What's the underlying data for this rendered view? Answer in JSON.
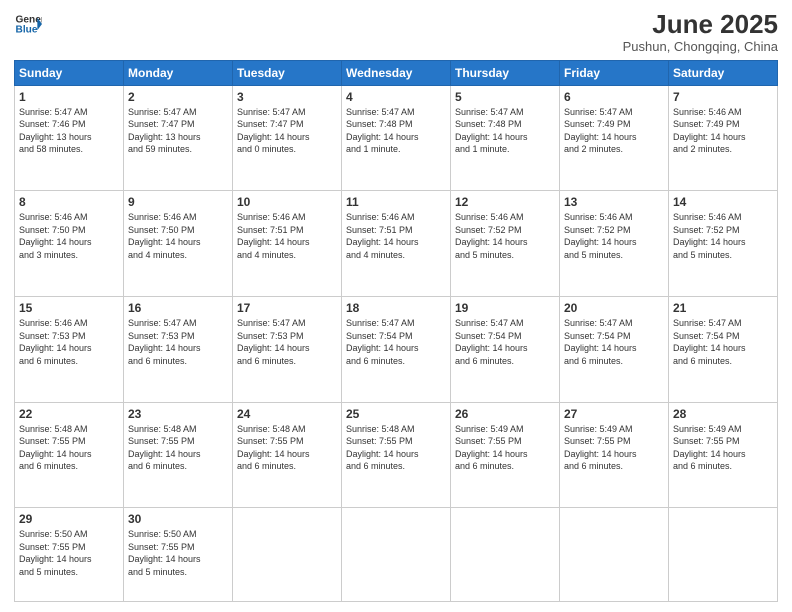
{
  "header": {
    "logo_line1": "General",
    "logo_line2": "Blue",
    "month_year": "June 2025",
    "location": "Pushun, Chongqing, China"
  },
  "weekdays": [
    "Sunday",
    "Monday",
    "Tuesday",
    "Wednesday",
    "Thursday",
    "Friday",
    "Saturday"
  ],
  "weeks": [
    [
      {
        "day": "1",
        "info": "Sunrise: 5:47 AM\nSunset: 7:46 PM\nDaylight: 13 hours\nand 58 minutes."
      },
      {
        "day": "2",
        "info": "Sunrise: 5:47 AM\nSunset: 7:47 PM\nDaylight: 13 hours\nand 59 minutes."
      },
      {
        "day": "3",
        "info": "Sunrise: 5:47 AM\nSunset: 7:47 PM\nDaylight: 14 hours\nand 0 minutes."
      },
      {
        "day": "4",
        "info": "Sunrise: 5:47 AM\nSunset: 7:48 PM\nDaylight: 14 hours\nand 1 minute."
      },
      {
        "day": "5",
        "info": "Sunrise: 5:47 AM\nSunset: 7:48 PM\nDaylight: 14 hours\nand 1 minute."
      },
      {
        "day": "6",
        "info": "Sunrise: 5:47 AM\nSunset: 7:49 PM\nDaylight: 14 hours\nand 2 minutes."
      },
      {
        "day": "7",
        "info": "Sunrise: 5:46 AM\nSunset: 7:49 PM\nDaylight: 14 hours\nand 2 minutes."
      }
    ],
    [
      {
        "day": "8",
        "info": "Sunrise: 5:46 AM\nSunset: 7:50 PM\nDaylight: 14 hours\nand 3 minutes."
      },
      {
        "day": "9",
        "info": "Sunrise: 5:46 AM\nSunset: 7:50 PM\nDaylight: 14 hours\nand 4 minutes."
      },
      {
        "day": "10",
        "info": "Sunrise: 5:46 AM\nSunset: 7:51 PM\nDaylight: 14 hours\nand 4 minutes."
      },
      {
        "day": "11",
        "info": "Sunrise: 5:46 AM\nSunset: 7:51 PM\nDaylight: 14 hours\nand 4 minutes."
      },
      {
        "day": "12",
        "info": "Sunrise: 5:46 AM\nSunset: 7:52 PM\nDaylight: 14 hours\nand 5 minutes."
      },
      {
        "day": "13",
        "info": "Sunrise: 5:46 AM\nSunset: 7:52 PM\nDaylight: 14 hours\nand 5 minutes."
      },
      {
        "day": "14",
        "info": "Sunrise: 5:46 AM\nSunset: 7:52 PM\nDaylight: 14 hours\nand 5 minutes."
      }
    ],
    [
      {
        "day": "15",
        "info": "Sunrise: 5:46 AM\nSunset: 7:53 PM\nDaylight: 14 hours\nand 6 minutes."
      },
      {
        "day": "16",
        "info": "Sunrise: 5:47 AM\nSunset: 7:53 PM\nDaylight: 14 hours\nand 6 minutes."
      },
      {
        "day": "17",
        "info": "Sunrise: 5:47 AM\nSunset: 7:53 PM\nDaylight: 14 hours\nand 6 minutes."
      },
      {
        "day": "18",
        "info": "Sunrise: 5:47 AM\nSunset: 7:54 PM\nDaylight: 14 hours\nand 6 minutes."
      },
      {
        "day": "19",
        "info": "Sunrise: 5:47 AM\nSunset: 7:54 PM\nDaylight: 14 hours\nand 6 minutes."
      },
      {
        "day": "20",
        "info": "Sunrise: 5:47 AM\nSunset: 7:54 PM\nDaylight: 14 hours\nand 6 minutes."
      },
      {
        "day": "21",
        "info": "Sunrise: 5:47 AM\nSunset: 7:54 PM\nDaylight: 14 hours\nand 6 minutes."
      }
    ],
    [
      {
        "day": "22",
        "info": "Sunrise: 5:48 AM\nSunset: 7:55 PM\nDaylight: 14 hours\nand 6 minutes."
      },
      {
        "day": "23",
        "info": "Sunrise: 5:48 AM\nSunset: 7:55 PM\nDaylight: 14 hours\nand 6 minutes."
      },
      {
        "day": "24",
        "info": "Sunrise: 5:48 AM\nSunset: 7:55 PM\nDaylight: 14 hours\nand 6 minutes."
      },
      {
        "day": "25",
        "info": "Sunrise: 5:48 AM\nSunset: 7:55 PM\nDaylight: 14 hours\nand 6 minutes."
      },
      {
        "day": "26",
        "info": "Sunrise: 5:49 AM\nSunset: 7:55 PM\nDaylight: 14 hours\nand 6 minutes."
      },
      {
        "day": "27",
        "info": "Sunrise: 5:49 AM\nSunset: 7:55 PM\nDaylight: 14 hours\nand 6 minutes."
      },
      {
        "day": "28",
        "info": "Sunrise: 5:49 AM\nSunset: 7:55 PM\nDaylight: 14 hours\nand 6 minutes."
      }
    ],
    [
      {
        "day": "29",
        "info": "Sunrise: 5:50 AM\nSunset: 7:55 PM\nDaylight: 14 hours\nand 5 minutes."
      },
      {
        "day": "30",
        "info": "Sunrise: 5:50 AM\nSunset: 7:55 PM\nDaylight: 14 hours\nand 5 minutes."
      },
      {
        "day": "",
        "info": ""
      },
      {
        "day": "",
        "info": ""
      },
      {
        "day": "",
        "info": ""
      },
      {
        "day": "",
        "info": ""
      },
      {
        "day": "",
        "info": ""
      }
    ]
  ]
}
